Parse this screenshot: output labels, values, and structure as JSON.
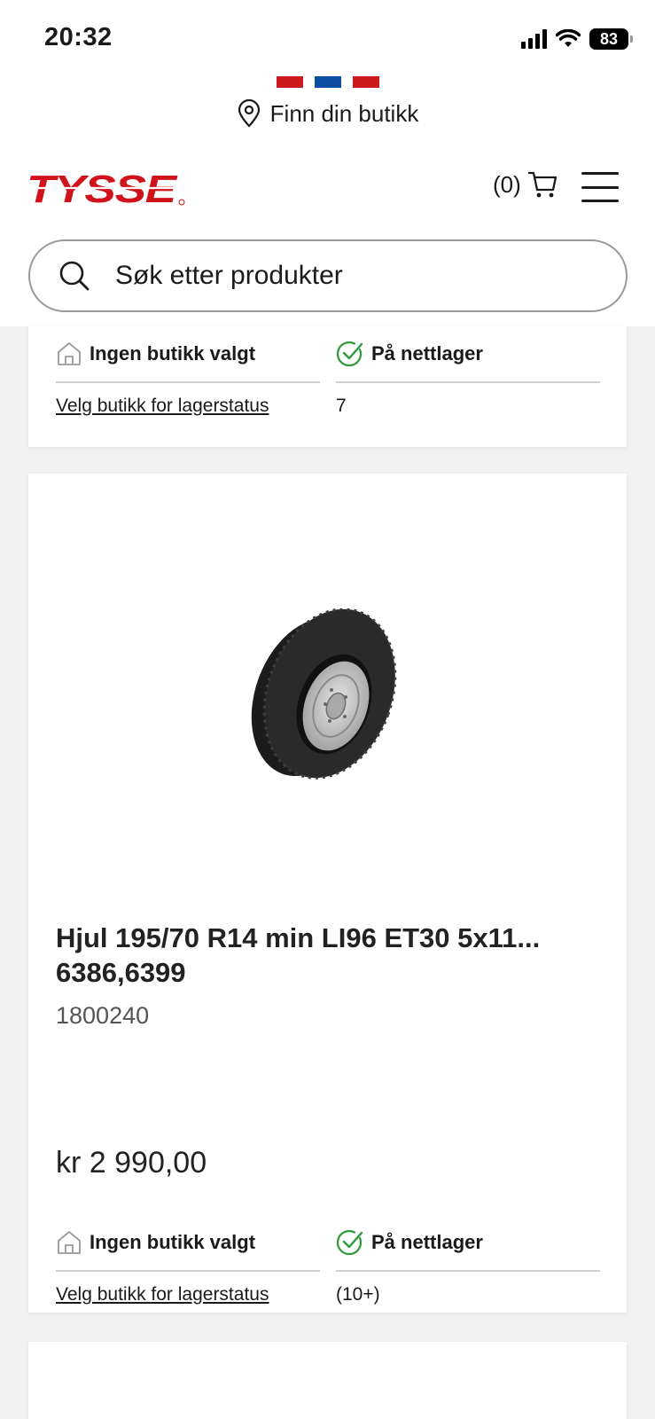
{
  "status_bar": {
    "time": "20:32",
    "battery": "83"
  },
  "header": {
    "flag_colors": [
      "#cc1a1f",
      "#0c4ea2",
      "#cc1a1f"
    ],
    "store_finder_label": "Finn din butikk",
    "logo_text": "TYSSE",
    "cart_count": "(0)",
    "brand_color": "#d0121b"
  },
  "search": {
    "placeholder": "Søk etter produkter"
  },
  "products": [
    {
      "store_status": "Ingen butikk valgt",
      "store_link": "Velg butikk for lagerstatus",
      "online_status": "På nettlager",
      "online_qty": "7"
    },
    {
      "title": "Hjul 195/70 R14 min LI96 ET30 5x11... 6386,6399",
      "sku": "1800240",
      "price": "kr 2 990,00",
      "store_status": "Ingen butikk valgt",
      "store_link": "Velg butikk for lagerstatus",
      "online_status": "På nettlager",
      "online_qty": "(10+)",
      "image_icon": "tire-wheel-image"
    }
  ],
  "colors": {
    "in_stock_green": "#2e9b3a"
  }
}
